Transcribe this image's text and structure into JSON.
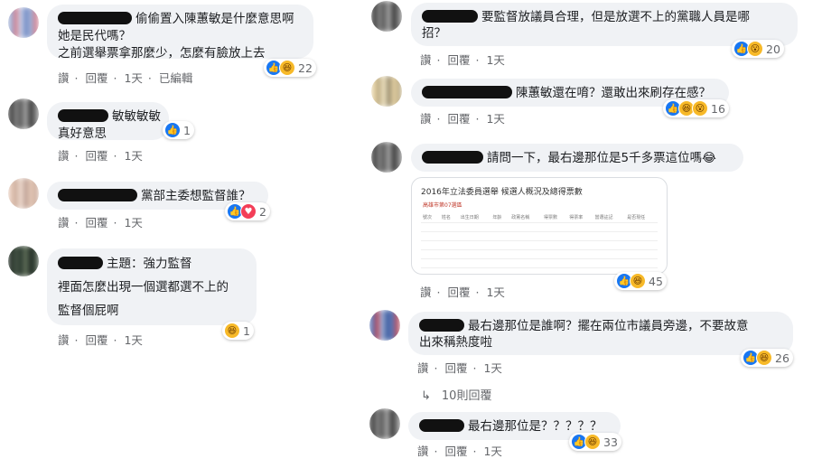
{
  "left": [
    {
      "id": "c1",
      "text_lines": [
        "偷偷置入陳蕙敏是什麼意思啊",
        "她是民代嗎？",
        "之前選舉票拿那麼少，怎麼有臉放上去"
      ],
      "actions": [
        "讚",
        "回覆",
        "1天",
        "已編輯"
      ],
      "reaction_count": "22"
    },
    {
      "id": "c2",
      "text_lines": [
        "敏敏敏敏",
        "真好意思"
      ],
      "actions": [
        "讚",
        "回覆",
        "1天"
      ],
      "reaction_count": "1"
    },
    {
      "id": "c3",
      "text_lines": [
        "黨部主委想監督誰？"
      ],
      "actions": [
        "讚",
        "回覆",
        "1天"
      ],
      "reaction_count": "2"
    },
    {
      "id": "c4",
      "text_lines": [
        "主題：強力監督",
        "裡面怎麼出現一個選都選不上的",
        "監督個屁啊"
      ],
      "actions": [
        "讚",
        "回覆",
        "1天"
      ],
      "reaction_count": "1"
    }
  ],
  "right": [
    {
      "id": "c5",
      "text_lines": [
        "要監督放議員合理，但是放選不上的黨職人員是哪",
        "招？"
      ],
      "actions": [
        "讚",
        "回覆",
        "1天"
      ],
      "reaction_count": "20"
    },
    {
      "id": "c6",
      "text_lines": [
        "陳蕙敏還在唷？還敢出來刷存在感？"
      ],
      "actions": [
        "讚",
        "回覆",
        "1天"
      ],
      "reaction_count": "16"
    },
    {
      "id": "c7",
      "text_lines": [
        "請問一下，最右邊那位是5千多票這位嗎😂"
      ],
      "actions": [
        "讚",
        "回覆",
        "1天"
      ],
      "reaction_count": "45"
    },
    {
      "id": "c8",
      "text_lines": [
        "最右邊那位是誰啊？擺在兩位市議員旁邊，不要故意",
        "出來稱熱度啦"
      ],
      "actions": [
        "讚",
        "回覆",
        "1天"
      ],
      "reaction_count": "26"
    },
    {
      "id": "c9",
      "text_lines": [
        "最右邊那位是？？？？？"
      ],
      "actions": [
        "讚",
        "回覆",
        "1天"
      ],
      "reaction_count": "33"
    }
  ],
  "more_replies": "10則回覆",
  "image": {
    "title": "2016年立法委員選舉 候選人概況及總得票數",
    "subtitle": "高雄市第07選區",
    "headers": [
      "號次",
      "姓名",
      "出生日期",
      "年齡",
      "政黨名稱",
      "得票數",
      "得票率",
      "當選註記",
      "是否現任"
    ]
  },
  "colors": {
    "like": "#1877f2",
    "haha": "#f7b928",
    "love": "#f33e58",
    "bubble": "#f0f2f5",
    "meta": "#65676b"
  }
}
